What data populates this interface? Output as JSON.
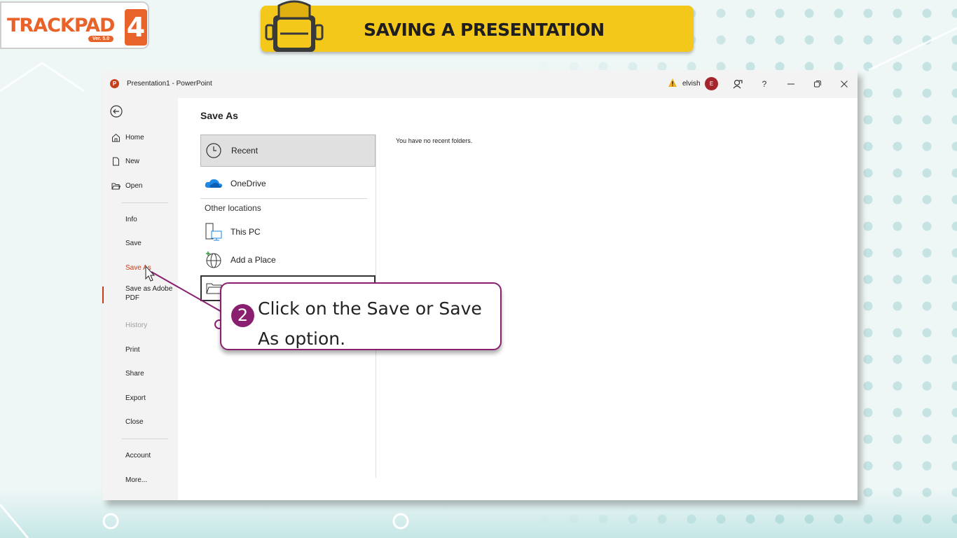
{
  "logo": {
    "text": "TRACKPAD",
    "version": "Ver. 5.0",
    "number": "4"
  },
  "banner": {
    "title": "SAVING A PRESENTATION"
  },
  "window": {
    "title": "Presentation1  -  PowerPoint",
    "user": {
      "name": "elvish",
      "initial": "E"
    },
    "controls": [
      "share-feedback-icon",
      "help-icon",
      "minimize-icon",
      "restore-icon",
      "close-icon"
    ],
    "help_label": "?"
  },
  "sidebar": {
    "items": [
      {
        "label": "Home",
        "icon": "home-icon"
      },
      {
        "label": "New",
        "icon": "new-doc-icon"
      },
      {
        "label": "Open",
        "icon": "folder-open-icon"
      },
      {
        "label": "Info"
      },
      {
        "label": "Save"
      },
      {
        "label": "Save As",
        "selected": true
      },
      {
        "label": "Save as Adobe PDF"
      },
      {
        "label": "History",
        "disabled": true
      },
      {
        "label": "Print"
      },
      {
        "label": "Share"
      },
      {
        "label": "Export"
      },
      {
        "label": "Close"
      },
      {
        "label": "Account"
      },
      {
        "label": "More..."
      }
    ]
  },
  "main": {
    "title": "Save As",
    "locations": [
      {
        "label": "Recent",
        "icon": "clock-icon",
        "selected": true
      },
      {
        "label": "OneDrive",
        "icon": "onedrive-icon"
      }
    ],
    "other_locations_label": "Other locations",
    "other_locations": [
      {
        "label": "This PC",
        "icon": "pc-icon"
      },
      {
        "label": "Add a Place",
        "icon": "globe-add-icon"
      },
      {
        "label": "",
        "icon": "folder-icon"
      }
    ],
    "no_recent_text": "You have no recent folders."
  },
  "callout": {
    "step": "2",
    "text": "Click on the Save or Save As option.",
    "accent": "#8a1f6f"
  },
  "colors": {
    "brand": "#e8632a",
    "banner": "#f4c81a",
    "powerpoint": "#c43e1c"
  }
}
